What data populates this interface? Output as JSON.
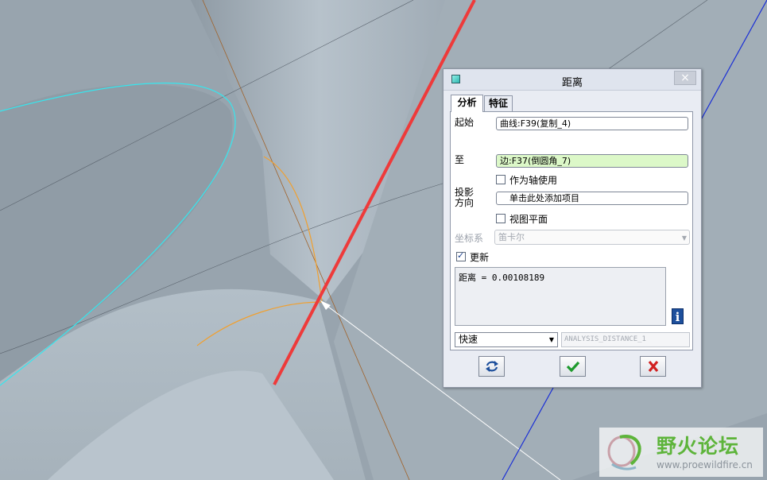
{
  "dialog": {
    "title": "距离",
    "close_label": "×",
    "tabs": [
      {
        "label": "分析",
        "active": true
      },
      {
        "label": "特征",
        "active": false
      }
    ],
    "from_label": "起始",
    "from_value": "曲线:F39(复制_4)",
    "to_label": "至",
    "to_value": "边:F37(倒圆角_7)",
    "use_as_axis_label": "作为轴使用",
    "projection_label_1": "投影",
    "projection_label_2": "方向",
    "projection_placeholder": "单击此处添加项目",
    "view_plane_label": "视图平面",
    "csys_label": "坐标系",
    "csys_value": "笛卡尔",
    "update_label": "更新",
    "update_checked": true,
    "result_text": "距离 = 0.00108189",
    "info_label": "i",
    "mode_value": "快速",
    "analysis_name": "ANALYSIS_DISTANCE_1"
  },
  "watermark": {
    "title": "野火论坛",
    "url": "www.proewildfire.cn"
  },
  "colors": {
    "model_surface": "#9aa6b0",
    "cyan_curve": "#36e6ee",
    "red_edge": "#ee3a3a",
    "orange_curve": "#f0a030",
    "blue_axis": "#1a2fd6"
  }
}
